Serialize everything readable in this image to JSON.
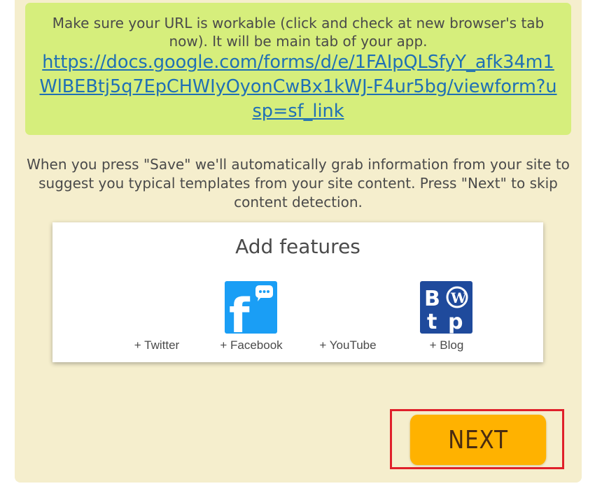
{
  "url_box": {
    "message": "Make sure your URL is workable (click and check at new browser's tab now). It will be main tab of your app.",
    "link": "https://docs.google.com/forms/d/e/1FAIpQLSfyY_afk34m1WlBEBtj5q7EpCHWIyOyonCwBx1kWJ-F4ur5bg/viewform?usp=sf_link"
  },
  "info_text": "When you press \"Save\" we'll automatically grab information from your site to suggest you typical templates from your site content. Press \"Next\" to skip content detection.",
  "features": {
    "title": "Add features",
    "items": [
      {
        "label": "+ Twitter",
        "icon": null
      },
      {
        "label": "+ Facebook",
        "icon": "facebook-icon"
      },
      {
        "label": "+ YouTube",
        "icon": null
      },
      {
        "label": "+ Blog",
        "icon": "blog-icon"
      }
    ]
  },
  "next_button": {
    "label": "NEXT"
  },
  "colors": {
    "panel_bg": "#f5eecd",
    "url_box_bg": "#d6ee7c",
    "link": "#1f6fb5",
    "next_bg": "#ffb200",
    "highlight_border": "#e0202a",
    "facebook_blue": "#1a9ef5",
    "blog_blue": "#1f4a9c"
  }
}
